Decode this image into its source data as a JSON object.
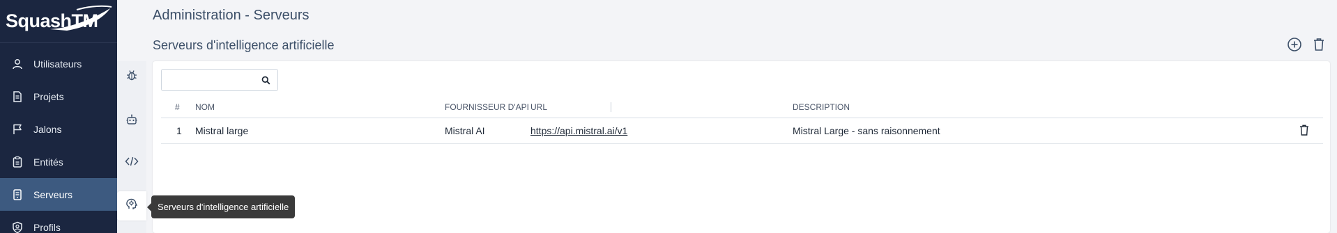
{
  "app": {
    "logo_text": "SquashTM",
    "page_title": "Administration - Serveurs",
    "section_title": "Serveurs d'intelligence artificielle"
  },
  "nav": {
    "items": [
      {
        "label": "Utilisateurs",
        "icon": "user-icon"
      },
      {
        "label": "Projets",
        "icon": "document-icon"
      },
      {
        "label": "Jalons",
        "icon": "flag-icon"
      },
      {
        "label": "Entités",
        "icon": "clipboard-icon"
      },
      {
        "label": "Serveurs",
        "icon": "server-icon",
        "active": true
      },
      {
        "label": "Profils",
        "icon": "shield-user-icon"
      }
    ]
  },
  "iconbar": {
    "items": [
      "bug-icon",
      "robot-icon",
      "code-icon",
      "ai-brain-icon"
    ],
    "active": "ai-brain-icon"
  },
  "tooltip": {
    "text": "Serveurs d'intelligence artificielle"
  },
  "search": {
    "value": "",
    "placeholder": ""
  },
  "table": {
    "columns": [
      "#",
      "NOM",
      "FOURNISSEUR D'API",
      "URL",
      "DESCRIPTION"
    ],
    "rows": [
      {
        "index": "1",
        "name": "Mistral large",
        "provider": "Mistral AI",
        "url": "https://api.mistral.ai/v1",
        "description": "Mistral Large - sans raisonnement"
      }
    ]
  },
  "colors": {
    "nav_bg": "#1b2640",
    "nav_active": "#3d5a80",
    "title": "#3c4f68",
    "page_bg": "#f3f4f7"
  }
}
